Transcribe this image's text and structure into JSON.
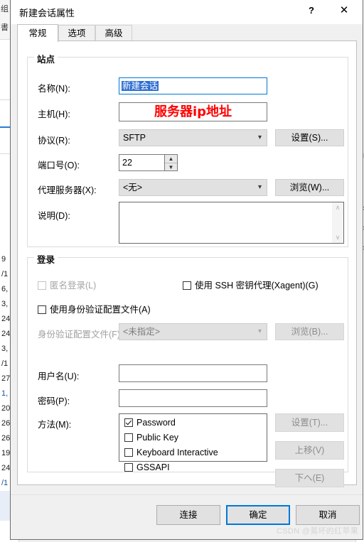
{
  "window": {
    "title": "新建会话属性",
    "help_icon": "?",
    "close_icon": "✕"
  },
  "tabs": [
    {
      "label": "常规",
      "active": true
    },
    {
      "label": "选项",
      "active": false
    },
    {
      "label": "高级",
      "active": false
    }
  ],
  "site": {
    "group_title": "站点",
    "name": {
      "label": "名称(N):",
      "value": "新建会话",
      "selected": true
    },
    "host": {
      "label": "主机(H):",
      "value": "",
      "annotation": "服务器ip地址"
    },
    "protocol": {
      "label": "协议(R):",
      "value": "SFTP",
      "settings_button": "设置(S)..."
    },
    "port": {
      "label": "端口号(O):",
      "value": "22",
      "up_icon": "▲",
      "down_icon": "▼"
    },
    "proxy": {
      "label": "代理服务器(X):",
      "value": "<无>",
      "browse_button": "浏览(W)..."
    },
    "description": {
      "label": "说明(D):",
      "value": "",
      "scroll_up_icon": "∧",
      "scroll_down_icon": "∨"
    }
  },
  "login": {
    "group_title": "登录",
    "anonymous": {
      "label": "匿名登录(L)",
      "checked": false,
      "enabled": false
    },
    "ssh_agent": {
      "label": "使用 SSH 密钥代理(Xagent)(G)",
      "checked": false,
      "enabled": true
    },
    "use_identity_file": {
      "label": "使用身份验证配置文件(A)",
      "checked": false,
      "enabled": true
    },
    "identity_file": {
      "label": "身份验证配置文件(F):",
      "value": "<未指定>",
      "browse_button": "浏览(B)...",
      "enabled": false
    },
    "username": {
      "label": "用户名(U):",
      "value": ""
    },
    "password": {
      "label": "密码(P):",
      "value": ""
    },
    "method": {
      "label": "方法(M):",
      "items": [
        {
          "label": "Password",
          "checked": true
        },
        {
          "label": "Public Key",
          "checked": false
        },
        {
          "label": "Keyboard Interactive",
          "checked": false
        },
        {
          "label": "GSSAPI",
          "checked": false
        }
      ],
      "buttons": [
        {
          "label": "设置(T)...",
          "enabled": false
        },
        {
          "label": "上移(V)",
          "enabled": false
        },
        {
          "label": "下へ(E)",
          "enabled": false
        }
      ]
    }
  },
  "footer": {
    "connect_button": "连接",
    "ok_button": "确定",
    "cancel_button": "取消",
    "watermark": "CSDN @蔫坏的红苹果"
  },
  "background": {
    "toolbar_glyphs": [
      "组",
      "書"
    ],
    "rows": [
      "9",
      "/1",
      "6,",
      "3,",
      "24",
      "24",
      "3,",
      "/1",
      "27",
      "1,",
      "20",
      "26",
      "26",
      "19",
      "24",
      "/1"
    ],
    "right_fragments": [
      "卽",
      "nF",
      "AF",
      "nF"
    ]
  },
  "colors": {
    "accent": "#0078d7",
    "selection": "#2d6ed1",
    "annotation": "#ff0000",
    "dialog_bg": "#f0f0f0",
    "page_bg": "#ffffff"
  }
}
